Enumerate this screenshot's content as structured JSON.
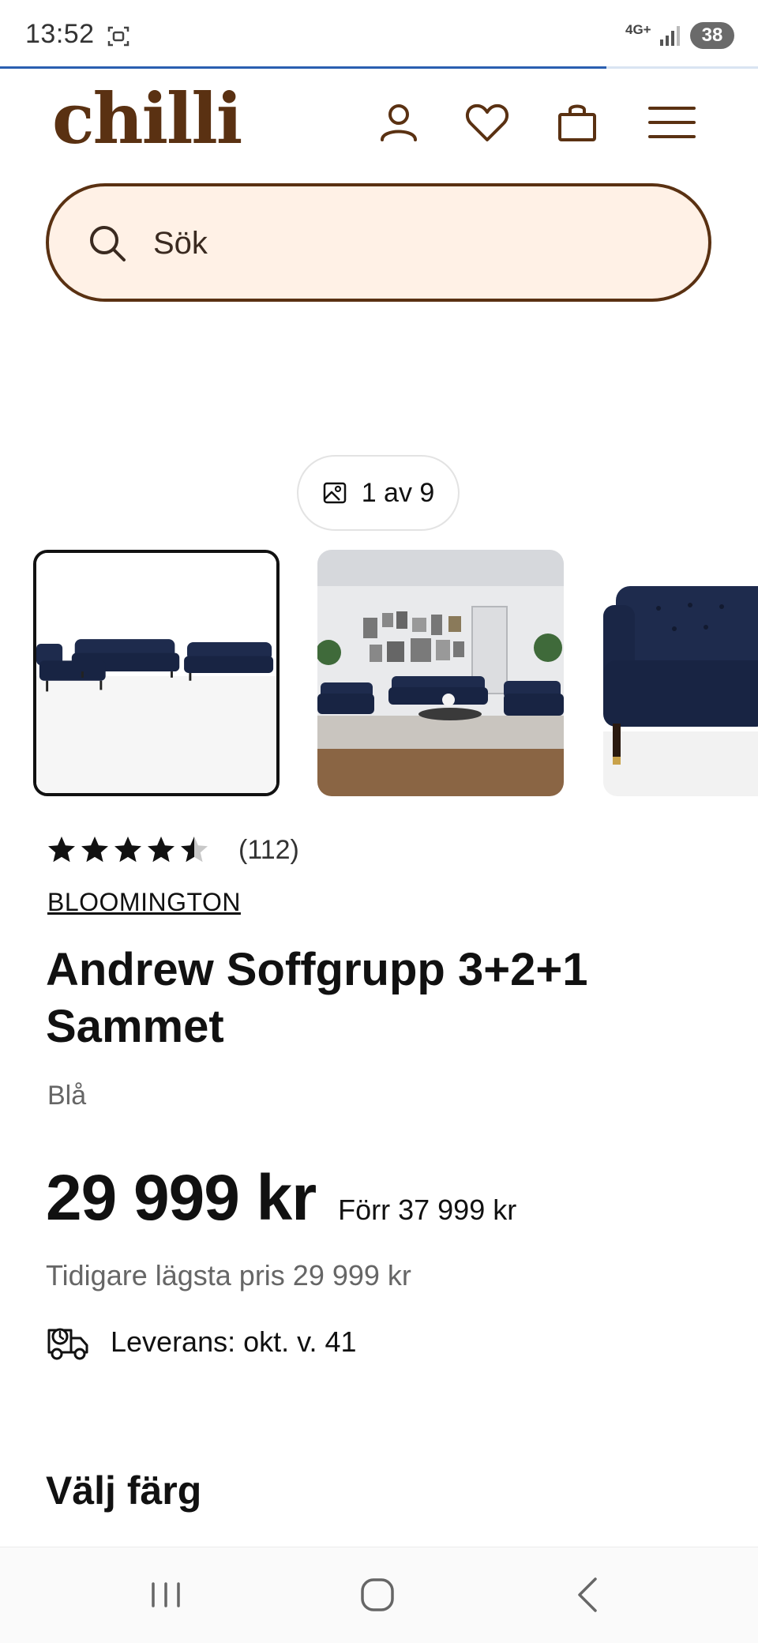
{
  "status_bar": {
    "time": "13:52",
    "network": "4G+",
    "battery": "38",
    "page_load_progress": 0.8
  },
  "header": {
    "logo": "chilli",
    "icons": [
      "account-icon",
      "heart-icon",
      "bag-icon",
      "menu-icon"
    ]
  },
  "search": {
    "placeholder": "Sök"
  },
  "gallery": {
    "counter": "1 av 9",
    "selected_index": 0,
    "thumbnails": [
      "product-photo-1",
      "product-photo-2",
      "product-photo-3"
    ]
  },
  "product": {
    "rating_stars": 4.5,
    "review_count": "(112)",
    "brand": "BLOOMINGTON",
    "title_line1": "Andrew Soffgrupp 3+2+1",
    "title_line2": "Sammet",
    "color": "Blå",
    "price": "29 999 kr",
    "price_before": "Förr 37 999 kr",
    "lowest_price": "Tidigare lägsta pris 29 999 kr",
    "delivery": "Leverans: okt. v. 41"
  },
  "section": {
    "choose_color": "Välj färg"
  },
  "colors": {
    "brand_brown": "#5a3112",
    "search_bg": "#fff1e6",
    "sofa_navy": "#1c2a4a"
  }
}
